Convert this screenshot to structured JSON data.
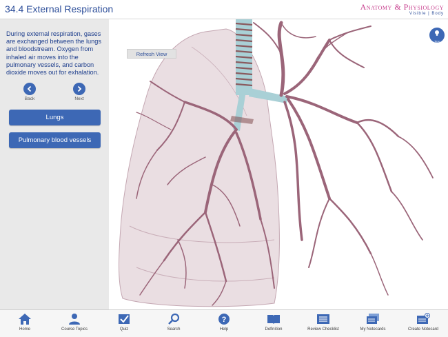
{
  "header": {
    "title": "34.4 External Respiration",
    "brand_main": "Anatomy & Physiology",
    "brand_sub": "Visible | Body"
  },
  "sidebar": {
    "description": "During external respiration, gases are exchanged between the lungs and bloodstream. Oxygen from inhaled air moves into the pulmonary vessels, and carbon dioxide moves out for exhalation.",
    "back_label": "Back",
    "next_label": "Next",
    "buttons": [
      {
        "label": "Lungs"
      },
      {
        "label": "Pulmonary blood vessels"
      }
    ]
  },
  "viewer": {
    "refresh_label": "Refresh View",
    "tips_label": "Tips"
  },
  "toolbar": [
    {
      "label": "Home",
      "icon": "home-icon"
    },
    {
      "label": "Course Topics",
      "icon": "person-icon"
    },
    {
      "label": "Quiz",
      "icon": "checkbox-icon"
    },
    {
      "label": "Search",
      "icon": "magnifier-icon"
    },
    {
      "label": "Help",
      "icon": "question-icon"
    },
    {
      "label": "Definition",
      "icon": "book-icon"
    },
    {
      "label": "Review Checklist",
      "icon": "checklist-icon"
    },
    {
      "label": "My Notecards",
      "icon": "notecards-icon"
    },
    {
      "label": "Create Notecard",
      "icon": "create-notecard-icon"
    }
  ],
  "colors": {
    "accent_blue": "#3d68b5",
    "title_blue": "#2e4f9a",
    "brand_magenta": "#c63c8c",
    "vessel": "#9b6579",
    "lung": "#d9c3cb"
  }
}
